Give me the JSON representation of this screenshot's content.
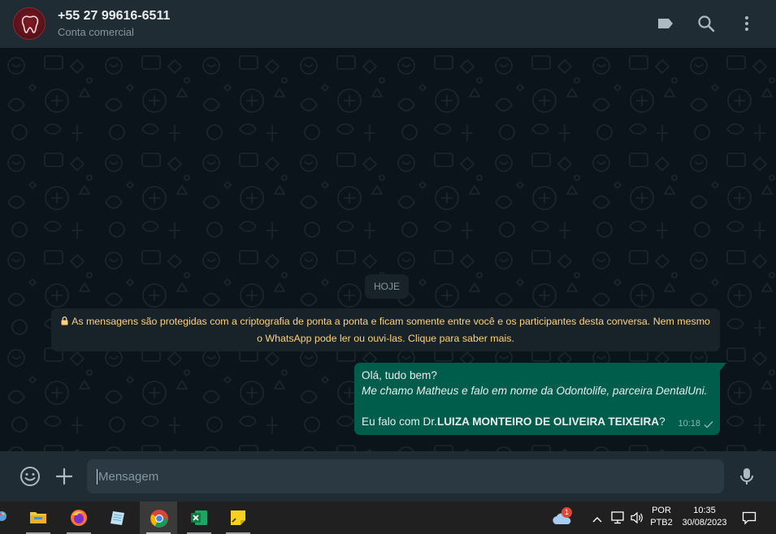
{
  "header": {
    "contact_name": "+55 27 99616-6511",
    "contact_subtitle": "Conta comercial",
    "icons": [
      "label-icon",
      "search-icon",
      "menu-icon"
    ]
  },
  "chat": {
    "date_chip": "HOJE",
    "encryption_notice": "As mensagens são protegidas com a criptografia de ponta a ponta e ficam somente entre você e os participantes desta conversa. Nem mesmo o WhatsApp pode ler ou ouvi-las. Clique para saber mais.",
    "encryption_line1": "As mensagens são protegidas com a criptografia de ponta a ponta e ficam somente entre você e os participantes desta conversa. Nem mesmo",
    "encryption_line2": "o WhatsApp pode ler ou ouvi-las. Clique para saber mais.",
    "messages": [
      {
        "line1": "Olá, tudo bem?",
        "line2": "Me chamo Matheus e falo em nome da Odontolife, parceira DentalUni.",
        "line3_prefix": "Eu falo com Dr.",
        "line3_bold": "LUIZA MONTEIRO DE OLIVEIRA TEIXEIRA",
        "line3_suffix": "?",
        "time": "10:18",
        "status": "sent"
      }
    ]
  },
  "composer": {
    "placeholder": "Mensagem",
    "value": ""
  },
  "taskbar": {
    "apps": [
      "file-explorer",
      "firefox",
      "notepad",
      "chrome",
      "excel",
      "sticky-notes"
    ],
    "active_app": "chrome",
    "weather_badge": "1",
    "language_top": "POR",
    "language_bottom": "PTB2",
    "clock_time": "10:35",
    "clock_date": "30/08/2023"
  },
  "colors": {
    "header_bg": "#202c33",
    "chat_bg": "#0b141a",
    "outgoing_bubble": "#005c4b",
    "notice_text": "#ffd279",
    "input_bg": "#2a3942"
  }
}
